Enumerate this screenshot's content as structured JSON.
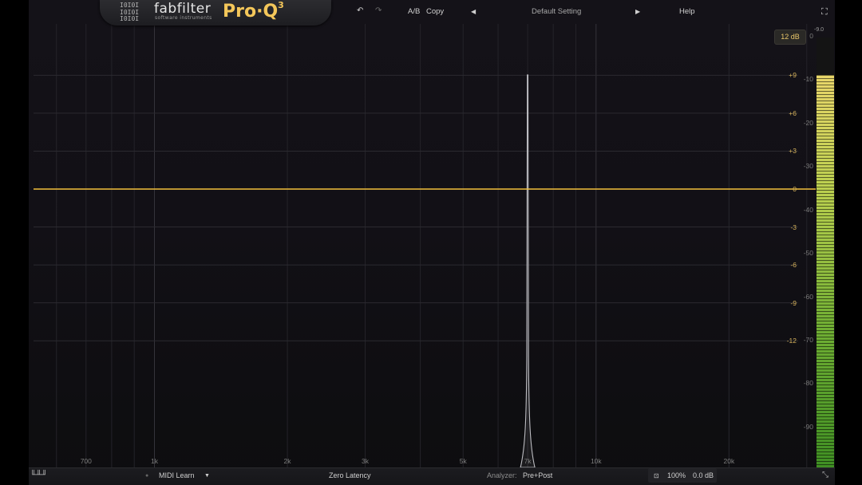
{
  "header": {
    "brand": "fabfilter",
    "brand_sub": "software instruments",
    "product": "Pro·Q",
    "product_version": "3",
    "ab_label": "A/B",
    "copy_label": "Copy",
    "preset_name": "Default Setting",
    "help_label": "Help"
  },
  "icons": {
    "undo": "undo-icon",
    "redo": "redo-icon",
    "prev_preset": "triangle-left-icon",
    "next_preset": "triangle-right-icon",
    "fullscreen": "fullscreen-icon",
    "piano": "piano-icon",
    "resize": "resize-icon",
    "midi_dot": "midi-dot-icon",
    "midi_arrow": "chevron-down-icon",
    "phase": "phase-icon"
  },
  "display_range": {
    "label": "12 dB"
  },
  "meter": {
    "peak_label": "-9.0",
    "level_db": -9.0
  },
  "chart_data": {
    "type": "line",
    "x_scale": "log",
    "x_ticks": [
      {
        "hz": 700,
        "label": "700"
      },
      {
        "hz": 1000,
        "label": "1k"
      },
      {
        "hz": 2000,
        "label": "2k"
      },
      {
        "hz": 3000,
        "label": "3k"
      },
      {
        "hz": 5000,
        "label": "5k"
      },
      {
        "hz": 7000,
        "label": "7k"
      },
      {
        "hz": 10000,
        "label": "10k"
      },
      {
        "hz": 20000,
        "label": "20k"
      }
    ],
    "eq_scale_labels": [
      "+9",
      "+6",
      "+3",
      "0",
      "-3",
      "-6",
      "-9",
      "-12"
    ],
    "eq_scale_values": [
      9,
      6,
      3,
      0,
      -3,
      -6,
      -9,
      -12
    ],
    "spectrum_scale_labels": [
      "0",
      "-10",
      "-20",
      "-30",
      "-40",
      "-50",
      "-60",
      "-70",
      "-80",
      "-90"
    ],
    "spectrum_scale_values": [
      0,
      -10,
      -20,
      -30,
      -40,
      -50,
      -60,
      -70,
      -80,
      -90
    ],
    "eq_curve_db": 0,
    "spectrum_peak": {
      "hz": 7000,
      "db": -9
    },
    "grid": true
  },
  "footer": {
    "midi_learn": "MIDI Learn",
    "latency": "Zero Latency",
    "analyzer_label": "Analyzer:",
    "analyzer_value": "Pre+Post",
    "zoom": "100%",
    "output_gain": "0.0 dB"
  },
  "colors": {
    "eq_curve": "#f1bf3c",
    "grid": "#2b2a30",
    "meter_top": "#e9d66a",
    "meter_bottom": "#3f8f23"
  }
}
